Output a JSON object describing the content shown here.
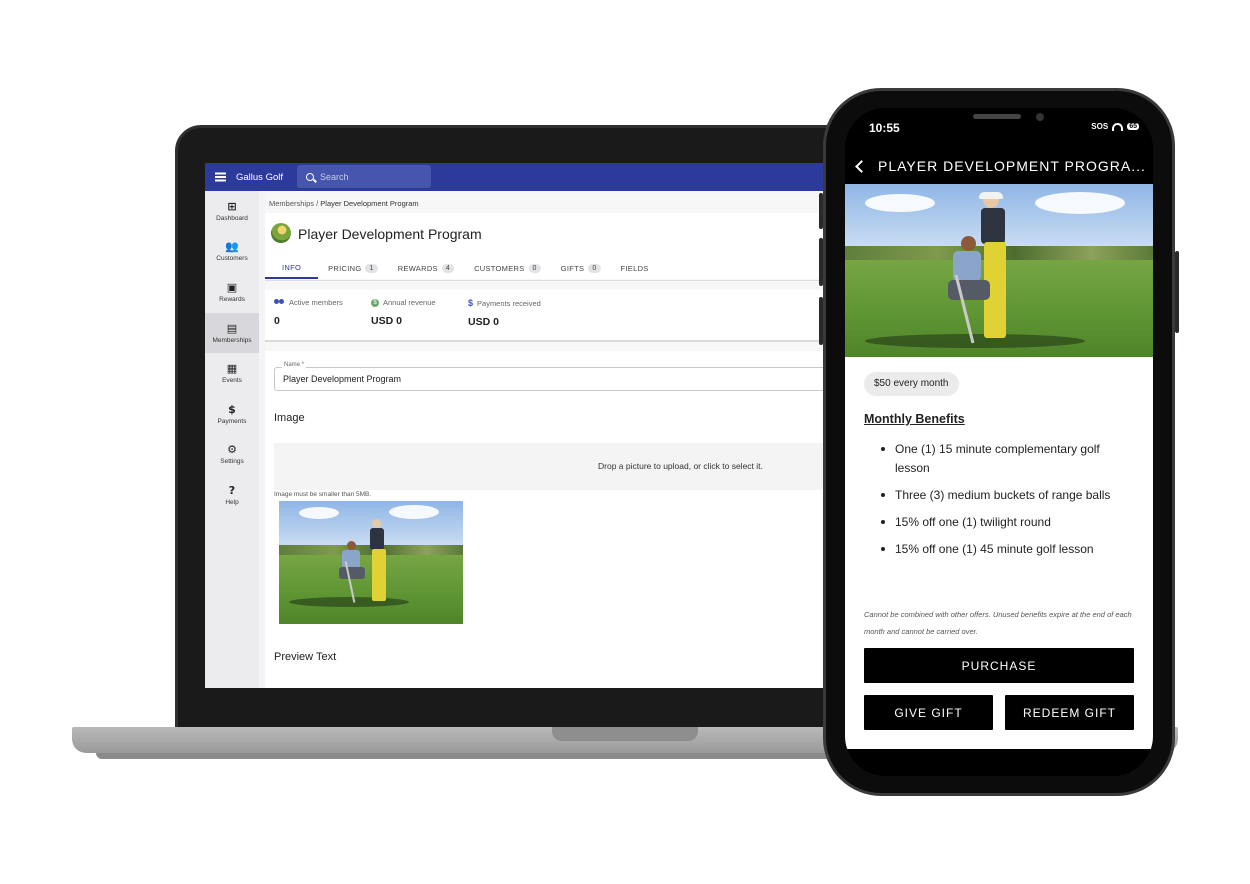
{
  "laptop": {
    "appbar": {
      "app_name": "Gallus Golf",
      "search_placeholder": "Search"
    },
    "sidebar": {
      "items": [
        {
          "label": "Dashboard",
          "icon": "grid-icon"
        },
        {
          "label": "Customers",
          "icon": "people-icon"
        },
        {
          "label": "Rewards",
          "icon": "gift-box-icon"
        },
        {
          "label": "Memberships",
          "icon": "id-badge-icon",
          "active": true
        },
        {
          "label": "Events",
          "icon": "calendar-icon"
        },
        {
          "label": "Payments",
          "icon": "dollar-icon"
        },
        {
          "label": "Settings",
          "icon": "gear-icon"
        },
        {
          "label": "Help",
          "icon": "help-icon"
        }
      ]
    },
    "breadcrumb": {
      "parent": "Memberships",
      "separator": "/",
      "current": "Player Development Program"
    },
    "page_title": "Player Development Program",
    "tabs": [
      {
        "label": "INFO",
        "active": true
      },
      {
        "label": "PRICING",
        "count": "1"
      },
      {
        "label": "REWARDS",
        "count": "4"
      },
      {
        "label": "CUSTOMERS",
        "count": "0"
      },
      {
        "label": "GIFTS",
        "count": "0"
      },
      {
        "label": "FIELDS"
      }
    ],
    "stats": [
      {
        "label": "Active members",
        "value": "0",
        "icon": "people-icon"
      },
      {
        "label": "Annual revenue",
        "value": "USD 0",
        "icon": "coin-icon"
      },
      {
        "label": "Payments received",
        "value": "USD 0",
        "icon": "dollar-icon"
      }
    ],
    "form": {
      "name_label": "Name *",
      "name_value": "Player Development Program",
      "image_heading": "Image",
      "dropzone_text": "Drop a picture to upload, or click to select it.",
      "image_hint": "Image must be smaller than 5MB.",
      "preview_heading": "Preview Text"
    }
  },
  "phone": {
    "status": {
      "time": "10:55",
      "carrier": "SOS",
      "battery": "65"
    },
    "title": "PLAYER DEVELOPMENT PROGRA...",
    "price_chip": "$50 every month",
    "benefits_heading": "Monthly Benefits",
    "benefits": [
      "One (1) 15 minute complementary golf lesson",
      "Three (3) medium buckets of range balls",
      "15% off one (1) twilight round",
      "15% off one (1) 45 minute golf lesson"
    ],
    "fine_print": "Cannot be combined with other offers. Unused benefits expire at the end of each month and cannot be carried over.",
    "purchase_label": "PURCHASE",
    "give_gift_label": "GIVE GIFT",
    "redeem_gift_label": "REDEEM GIFT"
  },
  "colors": {
    "brand": "#2b3a9b",
    "button": "#000000"
  }
}
